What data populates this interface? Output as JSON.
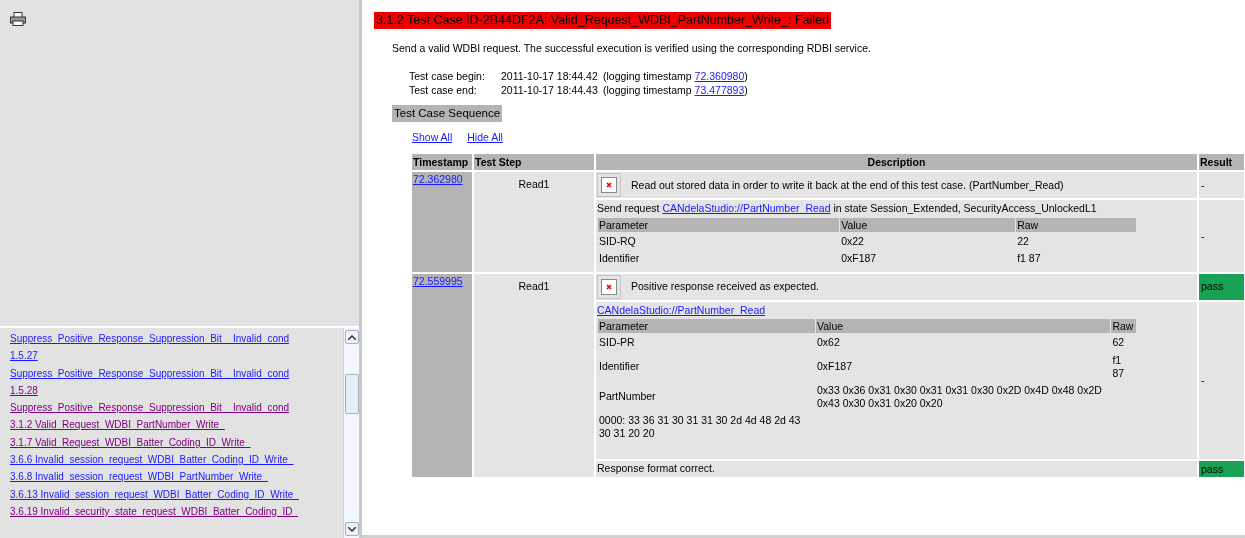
{
  "nav": {
    "items": [
      {
        "text": "Suppress_Positive_Response_Suppression_Bit__Invalid_cond",
        "visited": false
      },
      {
        "text": "1.5.27",
        "visited": false
      },
      {
        "text": "Suppress_Positive_Response_Suppression_Bit__Invalid_cond",
        "visited": false
      },
      {
        "text": "1.5.28",
        "visited": true
      },
      {
        "text": "Suppress_Positive_Response_Suppression_Bit__Invalid_cond",
        "visited": true
      },
      {
        "text": "3.1.2 Valid_Request_WDBI_PartNumber_Write_",
        "visited": true
      },
      {
        "text": "3.1.7 Valid_Request_WDBI_Batter_Coding_ID_Write_",
        "visited": true
      },
      {
        "text": "3.6.6 Invalid_session_request_WDBI_Batter_Coding_ID_Write_",
        "visited": false
      },
      {
        "text": "3.6.8 Invalid_session_request_WDBI_PartNumber_Write_",
        "visited": false
      },
      {
        "text": "3.6.13 Invalid_session_request_WDBI_Batter_Coding_ID_Write_",
        "visited": false
      },
      {
        "text": "3.6.19 Invalid_security_state_request_WDBI_Batter_Coding_ID_",
        "visited": true
      }
    ]
  },
  "title": {
    "text": "3.1.2 Test Case ID-2B44DF2A: Valid_Request_WDBI_PartNumber_Write_: Failed",
    "failed": true
  },
  "description": "Send a valid WDBI request. The successful execution is verified using the corresponding RDBI service.",
  "times": [
    {
      "label": "Test case begin:",
      "value": "2011-10-17 18:44.42",
      "note": "(logging timestamp",
      "link": "72.360980",
      "close": ")"
    },
    {
      "label": "Test case end:",
      "value": "2011-10-17 18:44.43",
      "note": "(logging timestamp",
      "link": "73.477893",
      "close": ")"
    }
  ],
  "sequence_heading": "Test Case Sequence",
  "links": [
    "Show All",
    "Hide All"
  ],
  "table": {
    "columns": [
      "Timestamp",
      "Test Step",
      "Description",
      "Result"
    ],
    "rows": [
      {
        "timestamp": "72.362980",
        "step": "Read1",
        "entries": [
          {
            "kind": "step",
            "text": "Read out stored data in order to write it back at the end of this test case. (PartNumber_Read)",
            "result": "-",
            "passed": false
          },
          {
            "kind": "request",
            "prefix": "Send request",
            "link": "CANdelaStudio://PartNumber_Read",
            "suffix": "in state Session_Extended, SecurityAccess_UnlockedL1",
            "params": {
              "columns": [
                "Parameter",
                "Value",
                "Raw"
              ],
              "rows": [
                [
                  "SID-RQ",
                  "0x22",
                  "22"
                ],
                [
                  "Identifier",
                  "0xF187",
                  "f1 87"
                ]
              ]
            },
            "result": "-",
            "passed": false
          }
        ]
      },
      {
        "timestamp": "72.559995",
        "step": "Read1",
        "entries": [
          {
            "kind": "step",
            "text": "Positive response received as expected.",
            "result": "pass",
            "passed": true
          },
          {
            "kind": "request",
            "link": "CANdelaStudio://PartNumber_Read",
            "params": {
              "columns": [
                "Parameter",
                "Value",
                "Raw"
              ],
              "rows": [
                [
                  "SID-PR",
                  "0x62",
                  "62"
                ],
                [
                  "Identifier",
                  "0xF187",
                  "f1 87"
                ],
                [
                  "PartNumber",
                  "0x33 0x36 0x31 0x30 0x31 0x31 0x30 0x2D 0x4D 0x48 0x2D 0x43 0x30 0x31 0x20 0x20",
                  ""
                ]
              ],
              "dump": "0000: 33 36 31 30 31 31 30 2d 4d 48 2d 43 30 31 20 20"
            },
            "result": "-",
            "passed": false
          },
          {
            "kind": "note",
            "text": "Response format correct.",
            "result": "pass",
            "passed": true
          }
        ]
      }
    ]
  }
}
